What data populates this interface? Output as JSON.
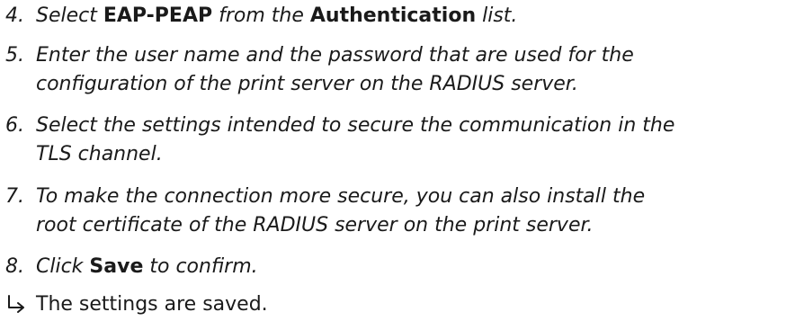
{
  "steps": [
    {
      "number": "4.",
      "text_1": "Select ",
      "bold_1": "EAP-PEAP",
      "text_2": " from the ",
      "bold_2": "Authentication",
      "text_3": " list."
    },
    {
      "number": "5.",
      "line_1": "Enter the user name and the password that are used for the",
      "line_2": "configuration of the print server on the RADIUS server."
    },
    {
      "number": "6.",
      "line_1": "Select the settings intended to secure the communication in the",
      "line_2": "TLS channel."
    },
    {
      "number": "7.",
      "line_1": "To make the connection more secure, you can also install the",
      "line_2": "root certificate of the RADIUS server on the print server."
    },
    {
      "number": "8.",
      "text_1": "Click ",
      "bold_1": "Save",
      "text_2": " to confirm."
    }
  ],
  "result": {
    "icon": "result-arrow-icon",
    "text": "The settings are saved."
  }
}
